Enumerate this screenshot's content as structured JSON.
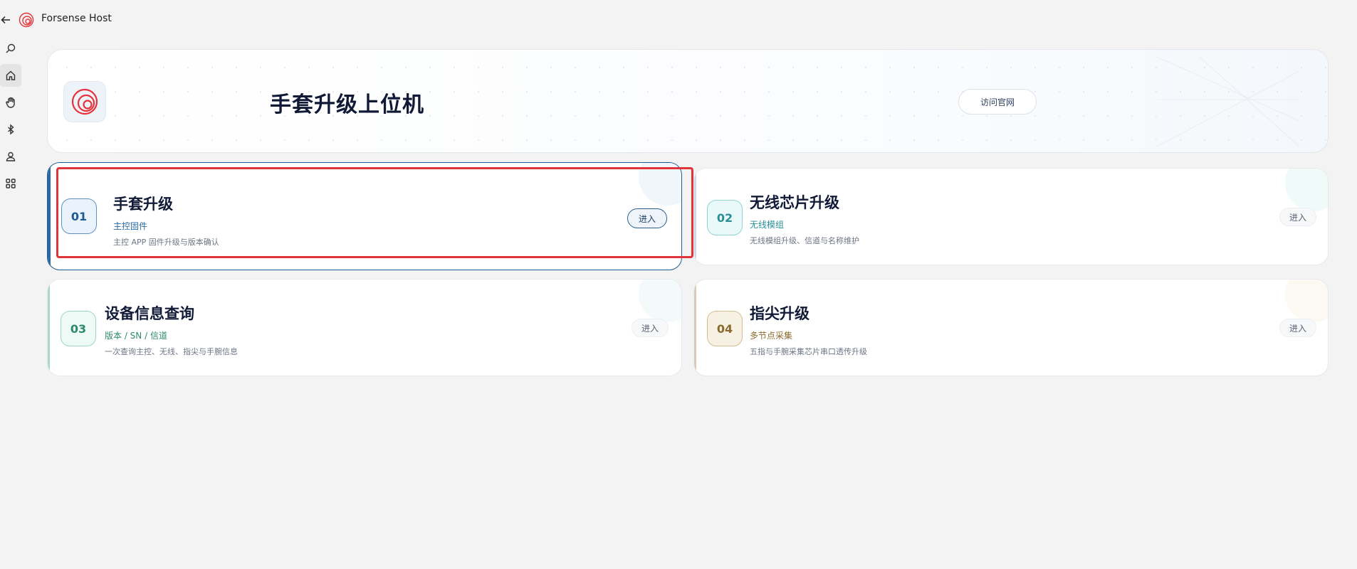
{
  "app": {
    "title": "Forsense Host"
  },
  "hero": {
    "title": "手套升级上位机",
    "site_button": "访问官网"
  },
  "cards": [
    {
      "num": "01",
      "name": "手套升级",
      "sub": "主控固件",
      "desc": "主控 APP 固件升级与版本确认",
      "enter": "进入"
    },
    {
      "num": "02",
      "name": "无线芯片升级",
      "sub": "无线模组",
      "desc": "无线模组升级、信道与名称维护",
      "enter": "进入"
    },
    {
      "num": "03",
      "name": "设备信息查询",
      "sub": "版本 / SN / 信道",
      "desc": "一次查询主控、无线、指尖与手腕信息",
      "enter": "进入"
    },
    {
      "num": "04",
      "name": "指尖升级",
      "sub": "多节点采集",
      "desc": "五指与手腕采集芯片串口透传升级",
      "enter": "进入"
    }
  ],
  "nav": [
    "search-icon",
    "home-icon",
    "hand-icon",
    "bluetooth-icon",
    "user-icon",
    "apps-icon"
  ],
  "colors": {
    "accent_blue": "#2a6aa3",
    "highlight_red": "#e0343a",
    "brand_red": "#e5333c"
  }
}
